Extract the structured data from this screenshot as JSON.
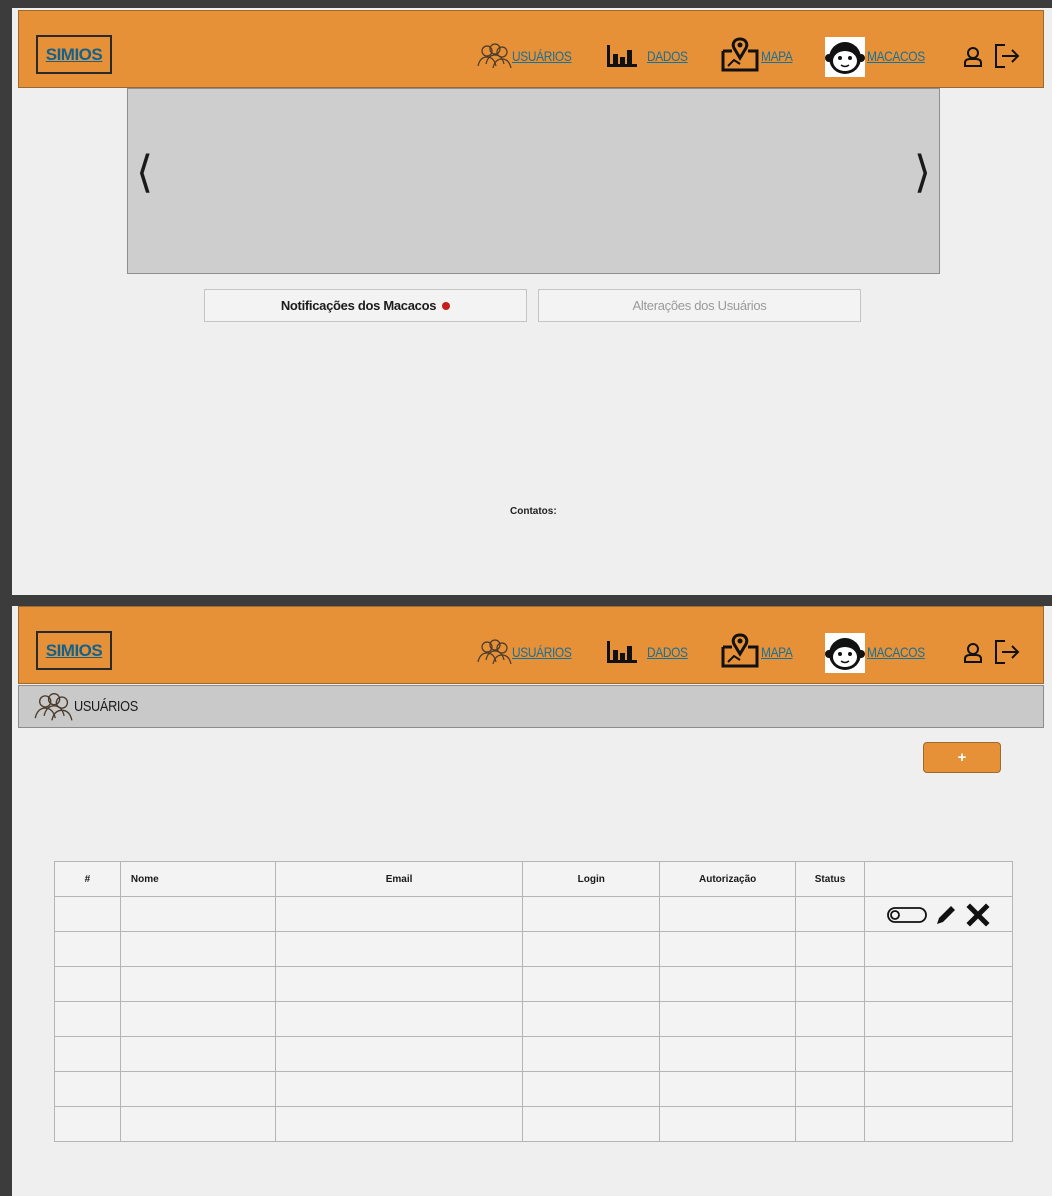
{
  "nav": {
    "brand": "SIMIOS",
    "links": {
      "usuarios": "USUÁRIOS",
      "dados": "DADOS",
      "mapa": "MAPA",
      "macacos": "MACACOS"
    }
  },
  "home": {
    "carousel": {
      "prev_icon": "chevron-left-icon",
      "next_icon": "chevron-right-icon"
    },
    "tabs": {
      "notificacoes": "Notificações dos Macacos",
      "alteracoes": "Alterações dos Usuários"
    },
    "contatos": "Contatos:"
  },
  "usuarios_page": {
    "header": "USUÁRIOS",
    "add_button": "+",
    "table": {
      "columns": [
        "#",
        "Nome",
        "Email",
        "Login",
        "Autorização",
        "Status",
        ""
      ],
      "rows": [
        [
          "",
          "",
          "",
          "",
          "",
          "",
          ""
        ],
        [
          "",
          "",
          "",
          "",
          "",
          "",
          ""
        ],
        [
          "",
          "",
          "",
          "",
          "",
          "",
          ""
        ],
        [
          "",
          "",
          "",
          "",
          "",
          "",
          ""
        ],
        [
          "",
          "",
          "",
          "",
          "",
          "",
          ""
        ],
        [
          "",
          "",
          "",
          "",
          "",
          "",
          ""
        ],
        [
          "",
          "",
          "",
          "",
          "",
          "",
          ""
        ]
      ],
      "row_actions": [
        "toggle-icon",
        "pencil-icon",
        "close-icon"
      ]
    }
  },
  "colors": {
    "navbar": "#e69038",
    "link": "#1b6f92",
    "background": "#efefef",
    "alert_dot": "#c81d1d"
  }
}
